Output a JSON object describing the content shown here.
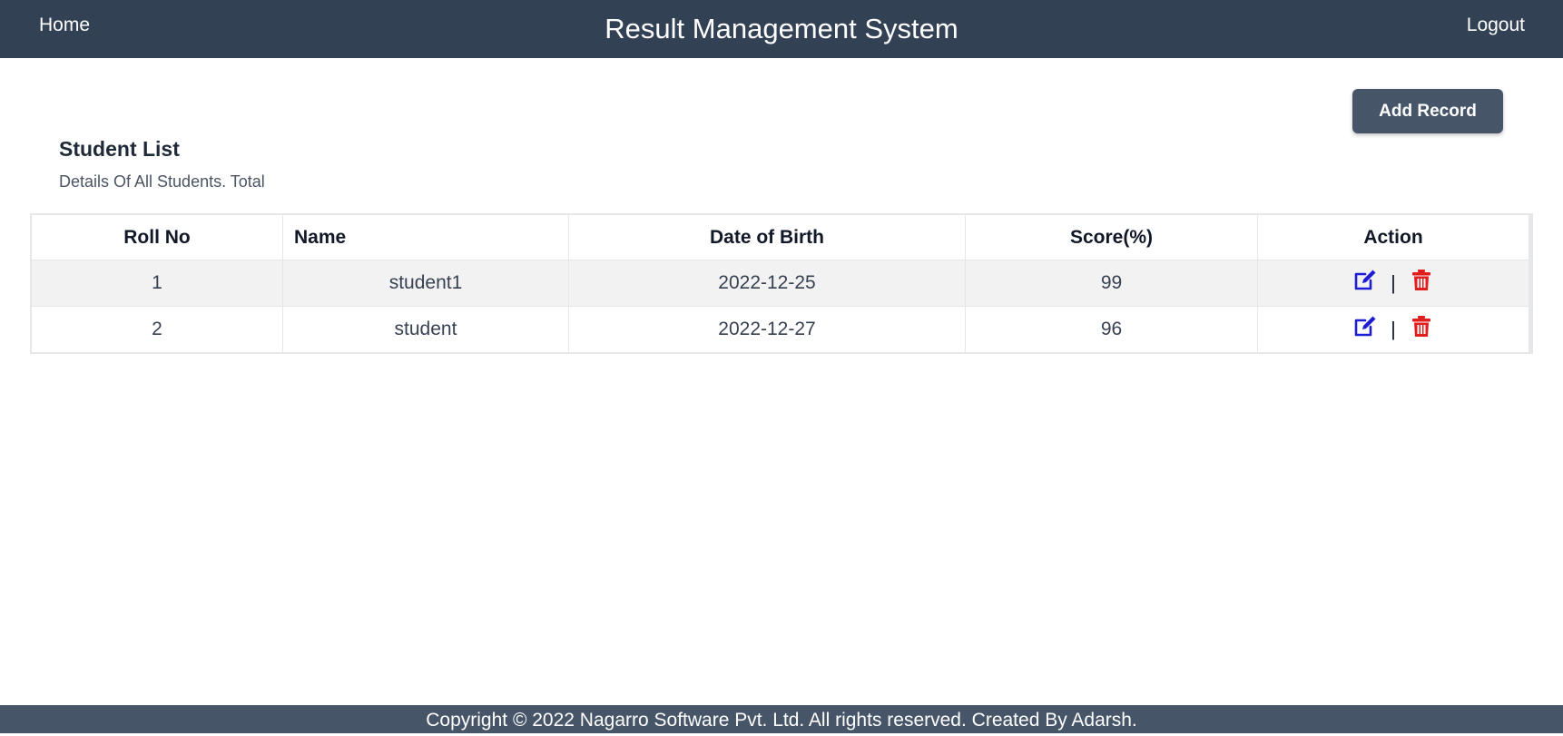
{
  "nav": {
    "home": "Home",
    "title": "Result Management System",
    "logout": "Logout"
  },
  "add_record_label": "Add Record",
  "list": {
    "title": "Student List",
    "subtitle": "Details Of All Students. Total"
  },
  "table": {
    "headers": [
      "Roll No",
      "Name",
      "Date of Birth",
      "Score(%)",
      "Action"
    ],
    "rows": [
      {
        "roll": "1",
        "name": "student1",
        "dob": "2022-12-25",
        "score": "99"
      },
      {
        "roll": "2",
        "name": "student",
        "dob": "2022-12-27",
        "score": "96"
      }
    ],
    "action_separator": "|"
  },
  "icons": {
    "edit": "edit-icon",
    "delete": "trash-icon"
  },
  "colors": {
    "navbar": "#334155",
    "button": "#475569",
    "footer": "#475569",
    "edit_icon": "#1d1dd6",
    "delete_icon": "#e11d1d"
  },
  "footer": {
    "text": "Copyright © 2022 Nagarro Software Pvt. Ltd. All rights reserved. Created By Adarsh."
  }
}
